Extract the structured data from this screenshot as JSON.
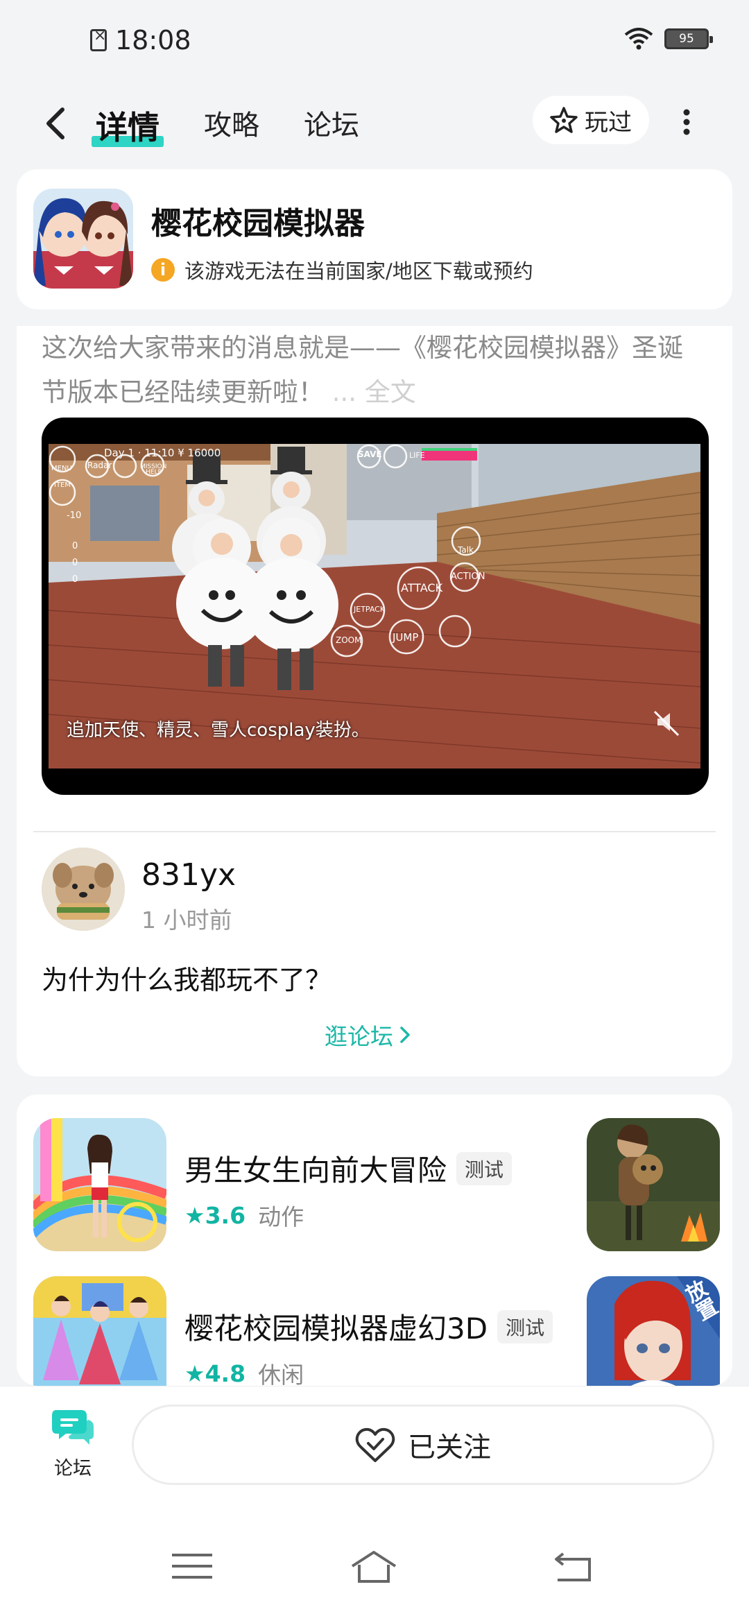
{
  "status_bar": {
    "time": "18:08",
    "battery": "95"
  },
  "nav": {
    "tabs": [
      {
        "label": "详情"
      },
      {
        "label": "攻略"
      },
      {
        "label": "论坛"
      }
    ],
    "played_label": "玩过"
  },
  "game": {
    "title": "樱花校园模拟器",
    "warning": "该游戏无法在当前国家/地区下载或预约"
  },
  "article": {
    "text": "这次给大家带来的消息就是——《樱花校园模拟器》圣诞节版本已经陆续更新啦！",
    "more": "... 全文",
    "video_caption": "追加天使、精灵、雪人cosplay装扮。",
    "video_hud": {
      "day_text": "Day 1 · 11:10 ¥ 16000",
      "save": "SAVE",
      "radar": "Radar",
      "menu": "MENU",
      "mission": "MISSION",
      "help": "HELP",
      "item": "ITEM",
      "talk": "Talk",
      "attack": "ATTACK",
      "action": "ACTION",
      "jetpack": "JETPACK",
      "jump": "JUMP",
      "zoom": "ZOOM",
      "life": "LIFE",
      "stat_heart": "0",
      "stat_friends": "0",
      "stat_angry": "0",
      "minus": "-10"
    }
  },
  "comment": {
    "username": "831yx",
    "time": "1 小时前",
    "text": "为什为什么我都玩不了？",
    "forum_link": "逛论坛"
  },
  "recommendations": [
    {
      "name": "男生女生向前大冒险",
      "tag": "测试",
      "rating": "3.6",
      "genre": "动作"
    },
    {
      "name": "樱花校园模拟器虚幻3D",
      "tag": "测试",
      "rating": "4.8",
      "genre": "休闲",
      "side_badge": "放置"
    }
  ],
  "bottom": {
    "forum_label": "论坛",
    "follow_label": "已关注"
  },
  "colors": {
    "accent": "#2ed4c4",
    "link": "#1bb8a8",
    "warning": "#f5a623"
  }
}
